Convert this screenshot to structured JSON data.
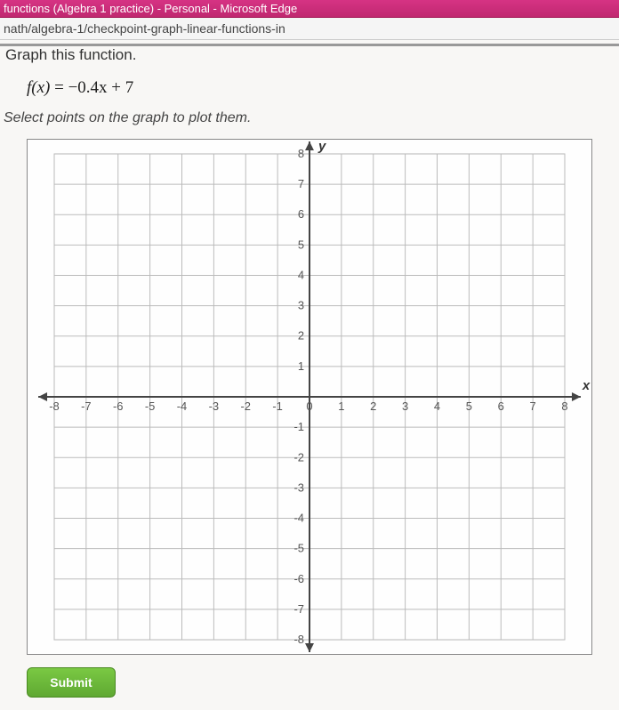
{
  "window": {
    "title": "functions (Algebra 1 practice) - Personal - Microsoft Edge",
    "url": "nath/algebra-1/checkpoint-graph-linear-functions-in"
  },
  "problem": {
    "instruction": "Graph this function.",
    "function_lhs": "f(x)",
    "function_eq": " = ",
    "function_rhs": "−0.4x + 7",
    "subinstruction": "Select points on the graph to plot them."
  },
  "chart_data": {
    "type": "scatter",
    "title": "",
    "xlabel": "x",
    "ylabel": "y",
    "xlim": [
      -8,
      8
    ],
    "ylim": [
      -8,
      8
    ],
    "xticks": [
      -8,
      -7,
      -6,
      -5,
      -4,
      -3,
      -2,
      -1,
      0,
      1,
      2,
      3,
      4,
      5,
      6,
      7,
      8
    ],
    "yticks": [
      -8,
      -7,
      -6,
      -5,
      -4,
      -3,
      -2,
      -1,
      1,
      2,
      3,
      4,
      5,
      6,
      7,
      8
    ],
    "grid": true,
    "series": []
  },
  "controls": {
    "submit": "Submit"
  }
}
